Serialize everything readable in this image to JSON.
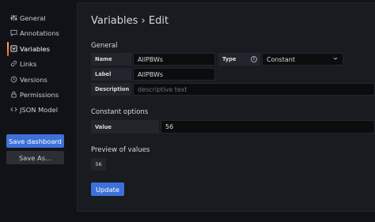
{
  "sidebar": {
    "items": [
      {
        "label": "General",
        "icon": "sliders-icon"
      },
      {
        "label": "Annotations",
        "icon": "comment-icon"
      },
      {
        "label": "Variables",
        "icon": "variables-icon"
      },
      {
        "label": "Links",
        "icon": "link-icon"
      },
      {
        "label": "Versions",
        "icon": "history-icon"
      },
      {
        "label": "Permissions",
        "icon": "lock-icon"
      },
      {
        "label": "JSON Model",
        "icon": "code-icon"
      }
    ],
    "active": "Variables",
    "save_dashboard_label": "Save dashboard",
    "save_as_label": "Save As..."
  },
  "main": {
    "title": "Variables › Edit",
    "general_heading": "General",
    "name_label": "Name",
    "name_value": "AllPBWs",
    "type_label": "Type",
    "type_value": "Constant",
    "label_label": "Label",
    "label_value": "AllPBWs",
    "description_label": "Description",
    "description_placeholder": "descriptive text",
    "constant_heading": "Constant options",
    "value_label": "Value",
    "value_value": "56",
    "preview_heading": "Preview of values",
    "preview_values": [
      "56"
    ],
    "update_label": "Update"
  },
  "colors": {
    "accent": "#3d71d9",
    "background": "#111217",
    "panel": "#181b1f"
  }
}
